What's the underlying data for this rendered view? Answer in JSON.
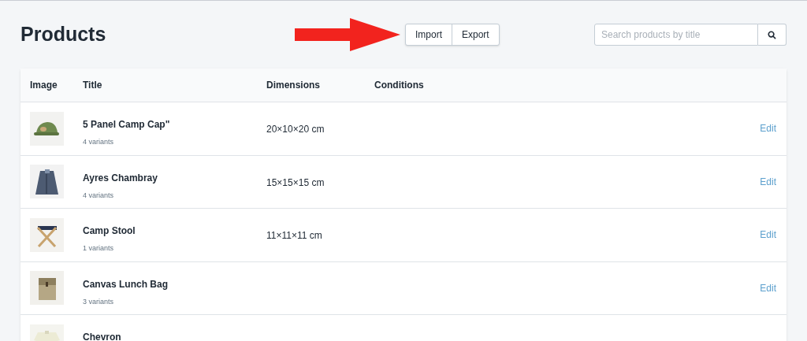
{
  "page_title": "Products",
  "actions": [
    "Import",
    "Export"
  ],
  "search": {
    "placeholder": "Search products by title"
  },
  "table": {
    "columns": [
      "Image",
      "Title",
      "Dimensions",
      "Conditions"
    ],
    "rows": [
      {
        "title": "5 Panel Camp Cap\"",
        "variants": "4 variants",
        "dimensions": "20×10×20 cm",
        "edit": "Edit"
      },
      {
        "title": "Ayres Chambray",
        "variants": "4 variants",
        "dimensions": "15×15×15 cm",
        "edit": "Edit"
      },
      {
        "title": "Camp Stool",
        "variants": "1 variants",
        "dimensions": "11×11×11 cm",
        "edit": "Edit"
      },
      {
        "title": "Canvas Lunch Bag",
        "variants": "3 variants",
        "edit": "Edit"
      },
      {
        "title": "Chevron"
      }
    ]
  }
}
